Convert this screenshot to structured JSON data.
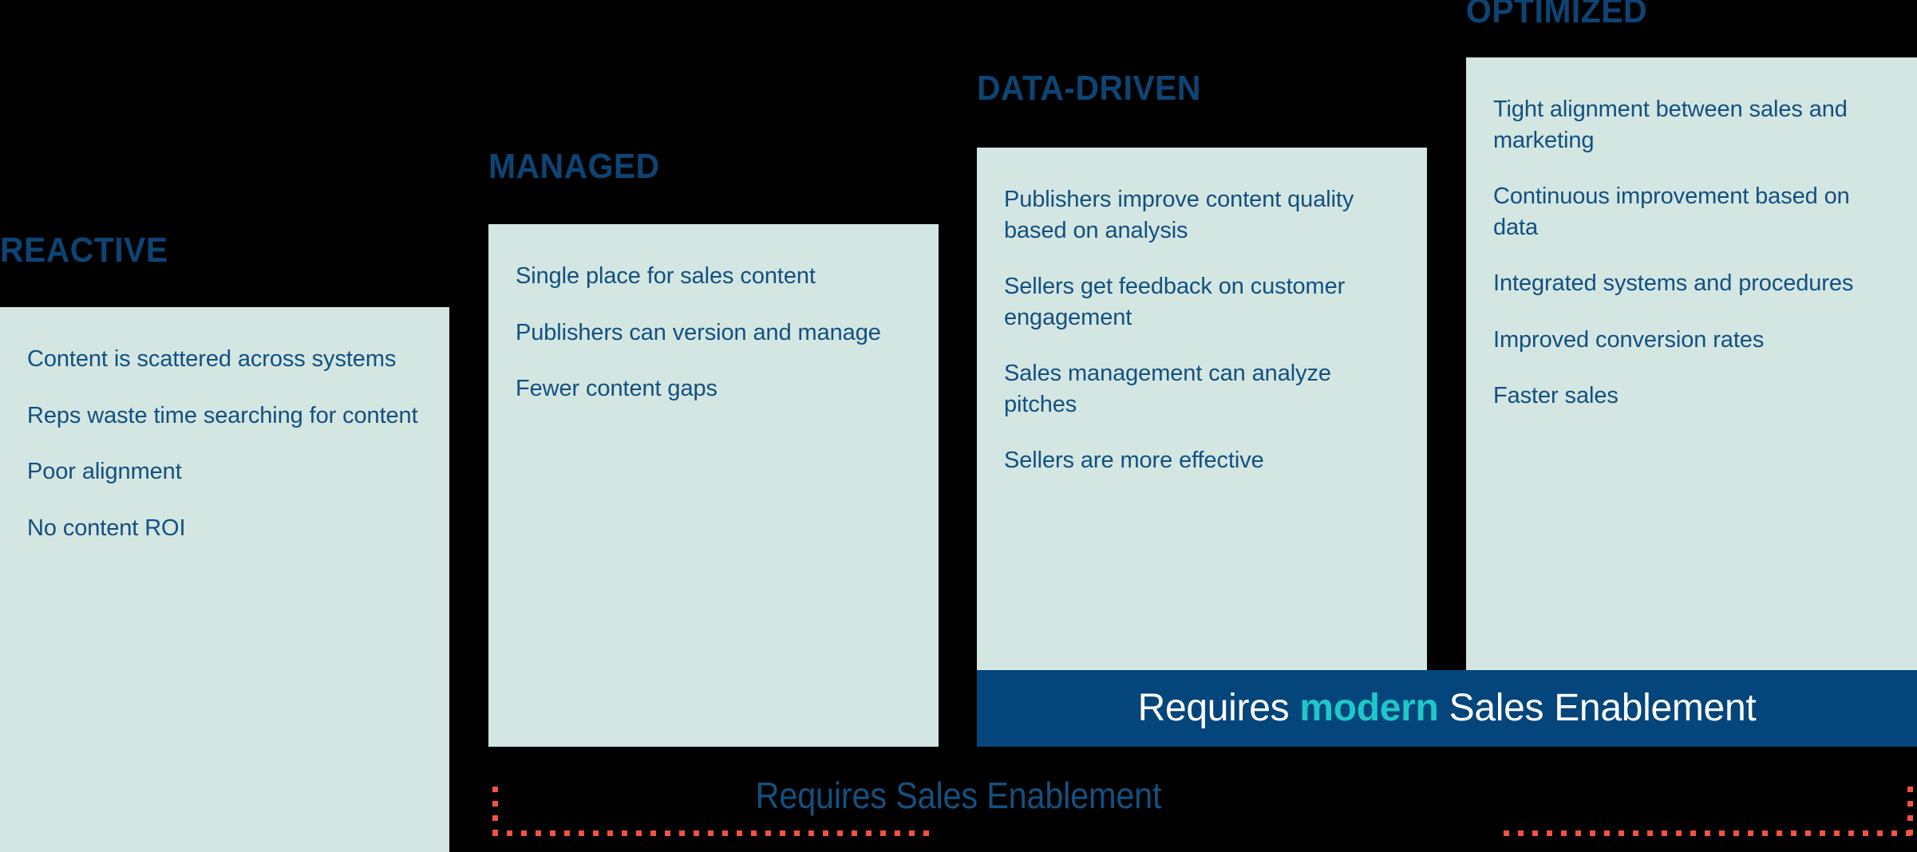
{
  "theme": {
    "background": "#000000",
    "panel_fill": "#d3e6e2",
    "heading_color": "#0d4474",
    "body_text_color": "#14507f",
    "banner_fill": "#04457c",
    "banner_text_color": "#ffffff",
    "banner_accent_color": "#1ec8c8",
    "dotted_line_color": "#f4533f"
  },
  "stages": [
    {
      "heading": "REACTIVE",
      "items": [
        "Content is scattered across systems",
        "Reps waste time searching for content",
        "Poor alignment",
        "No content ROI"
      ]
    },
    {
      "heading": "MANAGED",
      "items": [
        "Single place for sales content",
        "Publishers can version and manage",
        "Fewer content gaps"
      ]
    },
    {
      "heading": "DATA-DRIVEN",
      "items": [
        "Publishers improve content quality based on analysis",
        "Sellers get feedback on customer engagement",
        "Sales management can analyze pitches",
        "Sellers are more effective"
      ]
    },
    {
      "heading": "OPTIMIZED",
      "items": [
        "Tight alignment between sales and marketing",
        "Continuous improvement based on data",
        "Integrated systems and procedures",
        "Improved conversion rates",
        "Faster sales"
      ]
    }
  ],
  "modern_banner": {
    "prefix": "Requires ",
    "accent": "modern",
    "suffix": " Sales Enablement"
  },
  "requires_band": {
    "label": "Requires Sales Enablement"
  }
}
